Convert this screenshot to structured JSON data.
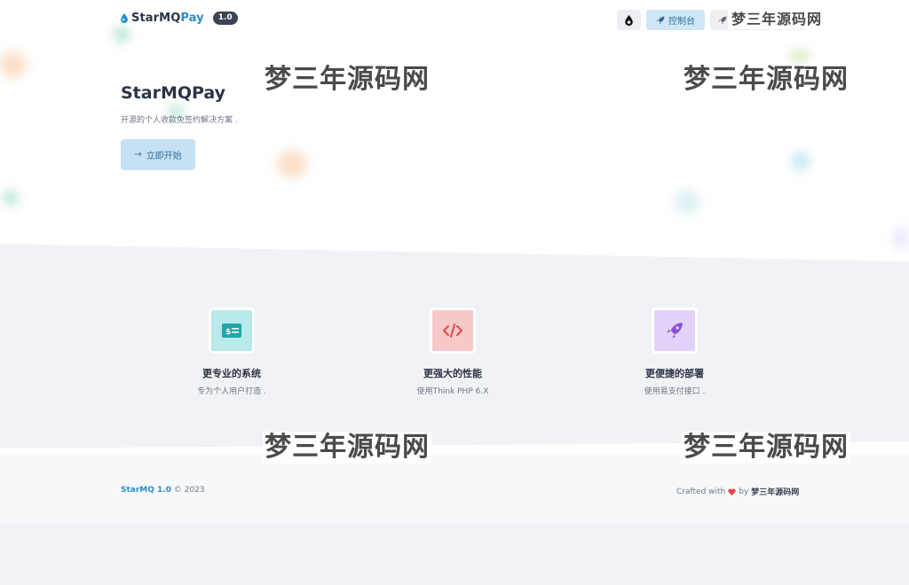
{
  "brand": {
    "name_part1": "StarMQ",
    "name_part2": "Pay",
    "version": "1.0"
  },
  "top_actions": {
    "console_label": "控制台"
  },
  "hero": {
    "title": "StarMQPay",
    "subtitle": "开源的个人收款免签约解决方案 .",
    "start_label": "立即开始"
  },
  "features": [
    {
      "title": "更专业的系统",
      "desc": "专为个人用户打造 .",
      "icon": "money-bill-icon",
      "bg": "#b9e9ea",
      "fg": "#1fa7a8"
    },
    {
      "title": "更强大的性能",
      "desc": "使用Think PHP 6.X",
      "icon": "code-icon",
      "bg": "#f6c9c9",
      "fg": "#e04848"
    },
    {
      "title": "更便捷的部署",
      "desc": "使用易支付接口 .",
      "icon": "rocket-icon",
      "bg": "#e2d3fb",
      "fg": "#8a4ddb"
    }
  ],
  "footer": {
    "brand": "StarMQ 1.0",
    "copyright": "© 2023",
    "crafted": "Crafted with",
    "by": "by",
    "author": "梦三年源码网"
  },
  "watermark": {
    "text": "梦三年源码网"
  },
  "colors": {
    "accent": "#2a8fcf",
    "heart": "#e04848"
  }
}
